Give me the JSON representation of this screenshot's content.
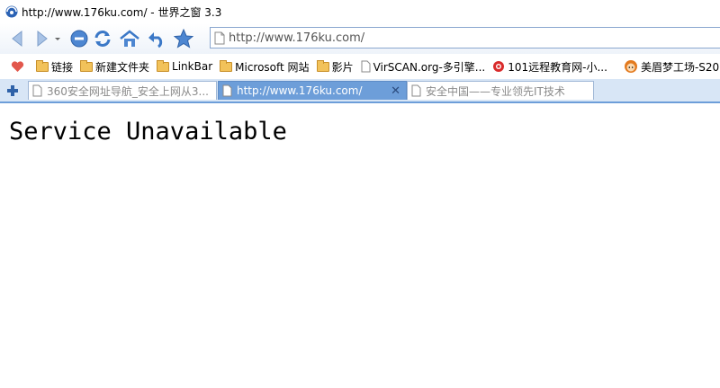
{
  "window": {
    "title": "http://www.176ku.com/ - 世界之窗 3.3"
  },
  "toolbar": {
    "back": "back-icon",
    "forward": "forward-icon",
    "dropdown": "chevron-down-icon",
    "stop": "stop-icon",
    "refresh": "refresh-icon",
    "home": "home-icon",
    "undo": "undo-close-icon",
    "favorite": "star-icon"
  },
  "address": {
    "url_host": "http://www.176ku.com",
    "url_path": "/"
  },
  "bookmarks": [
    {
      "icon": "heart-icon",
      "label": ""
    },
    {
      "icon": "folder-icon",
      "label": "链接"
    },
    {
      "icon": "folder-icon",
      "label": "新建文件夹"
    },
    {
      "icon": "folder-icon",
      "label": "LinkBar"
    },
    {
      "icon": "folder-icon",
      "label": "Microsoft 网站"
    },
    {
      "icon": "folder-icon",
      "label": "影片"
    },
    {
      "icon": "page-icon",
      "label": "VirSCAN.org-多引擎..."
    },
    {
      "icon": "lifebuoy-icon",
      "label": "101远程教育网-小..."
    },
    {
      "icon": "avatar-icon",
      "label": "美眉梦工场-S20"
    }
  ],
  "tabs": [
    {
      "label": "360安全网址导航_安全上网从3...",
      "active": false
    },
    {
      "label": "http://www.176ku.com/",
      "active": true
    },
    {
      "label": "安全中国——专业领先IT技术",
      "active": false
    }
  ],
  "page": {
    "message": "Service Unavailable"
  },
  "colors": {
    "accent": "#6d9ed9",
    "tab_bar": "#d8e6f6",
    "folder": "#f2c25a"
  }
}
